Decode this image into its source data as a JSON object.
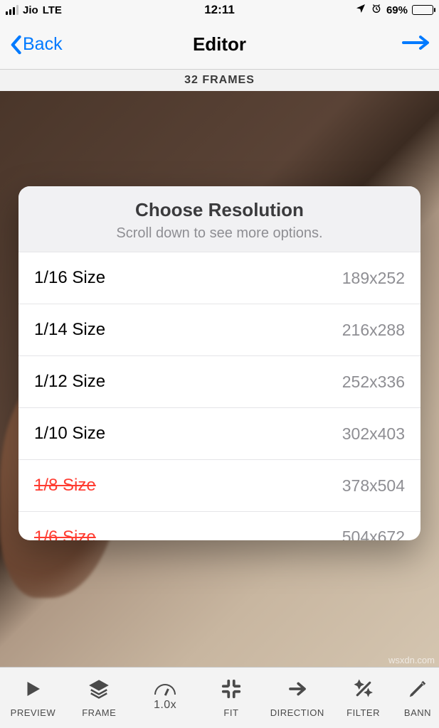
{
  "status": {
    "carrier": "Jio",
    "network": "LTE",
    "time": "12:11",
    "battery_pct": "69%"
  },
  "nav": {
    "back_label": "Back",
    "title": "Editor"
  },
  "frames_bar": "32 FRAMES",
  "modal": {
    "title": "Choose Resolution",
    "subtitle": "Scroll down to see more options.",
    "options": [
      {
        "label": "1/16 Size",
        "value": "189x252",
        "disabled": false
      },
      {
        "label": "1/14 Size",
        "value": "216x288",
        "disabled": false
      },
      {
        "label": "1/12 Size",
        "value": "252x336",
        "disabled": false
      },
      {
        "label": "1/10 Size",
        "value": "302x403",
        "disabled": false
      },
      {
        "label": "1/8 Size",
        "value": "378x504",
        "disabled": true
      },
      {
        "label": "1/6 Size",
        "value": "504x672",
        "disabled": true
      }
    ]
  },
  "toolbar": {
    "items": [
      {
        "label": "PREVIEW"
      },
      {
        "label": "FRAME"
      },
      {
        "label": "1.0x"
      },
      {
        "label": "FIT"
      },
      {
        "label": "DIRECTION"
      },
      {
        "label": "FILTER"
      },
      {
        "label": "BANN"
      }
    ]
  },
  "watermark": "wsxdn.com"
}
